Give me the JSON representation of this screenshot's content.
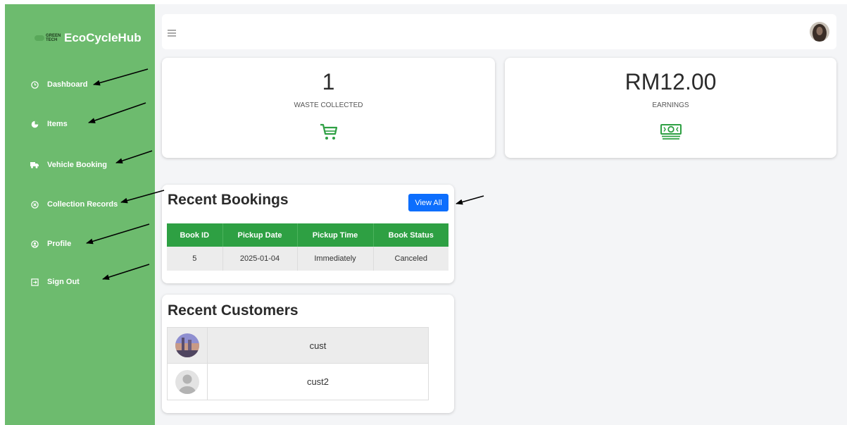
{
  "brand": {
    "name": "EcoCycleHub",
    "logo_text": "GREEN TECH"
  },
  "sidebar": {
    "items": [
      {
        "label": "Dashboard",
        "icon": "clock-icon"
      },
      {
        "label": "Items",
        "icon": "pie-chart-icon"
      },
      {
        "label": "Vehicle Booking",
        "icon": "truck-icon"
      },
      {
        "label": "Collection Records",
        "icon": "circle-x-icon"
      },
      {
        "label": "Profile",
        "icon": "user-circle-icon"
      },
      {
        "label": "Sign Out",
        "icon": "logout-icon"
      }
    ]
  },
  "stats": [
    {
      "value": "1",
      "label": "WASTE COLLECTED",
      "icon": "cart-icon"
    },
    {
      "value": "RM12.00",
      "label": "EARNINGS",
      "icon": "money-icon"
    }
  ],
  "recent_bookings": {
    "title": "Recent Bookings",
    "view_all_label": "View All",
    "columns": [
      "Book ID",
      "Pickup Date",
      "Pickup Time",
      "Book Status"
    ],
    "rows": [
      [
        "5",
        "2025-01-04",
        "Immediately",
        "Canceled"
      ]
    ]
  },
  "recent_customers": {
    "title": "Recent Customers",
    "rows": [
      {
        "name": "cust",
        "avatar": "photo-avatar"
      },
      {
        "name": "cust2",
        "avatar": "default-avatar"
      }
    ]
  },
  "colors": {
    "sidebar": "#6dbb6e",
    "table_header": "#2ea043",
    "primary_button": "#0d6efd",
    "icon_green": "#2ea043"
  }
}
